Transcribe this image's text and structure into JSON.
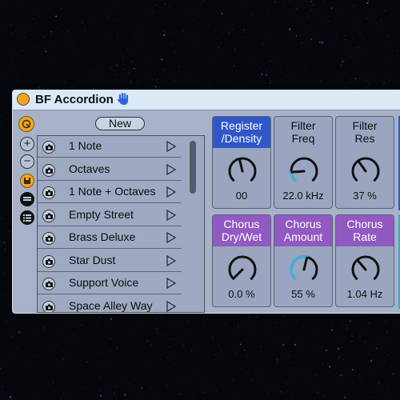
{
  "device": {
    "title": "BF Accordion",
    "icons": {
      "power": "power-icon",
      "hand": "hand-icon",
      "hot_swap": "hot-swap-icon",
      "add": "plus-icon",
      "remove": "minus-icon",
      "save": "save-icon",
      "folder": "folder-icon",
      "list": "list-icon"
    },
    "colors": {
      "accent_orange": "#f0a522",
      "header_blue": "#2f57c8",
      "header_purple": "#9159c2",
      "knob_cyan": "#38b6e6"
    }
  },
  "presets": {
    "new_label": "New",
    "items": [
      {
        "label": "1 Note"
      },
      {
        "label": "Octaves"
      },
      {
        "label": "1 Note + Octaves"
      },
      {
        "label": "Empty Street"
      },
      {
        "label": "Brass Deluxe"
      },
      {
        "label": "Star Dust"
      },
      {
        "label": "Support Voice"
      },
      {
        "label": "Space Alley Way"
      }
    ]
  },
  "knobs": [
    {
      "label_line1": "Register",
      "label_line2": "/Density",
      "value": "00",
      "header": "blue",
      "position": 0.45,
      "arc": false
    },
    {
      "label_line1": "Filter",
      "label_line2": "Freq",
      "value": "22.0 kHz",
      "header": "plain",
      "position": 0.15,
      "arc": true
    },
    {
      "label_line1": "Filter",
      "label_line2": "Res",
      "value": "37 %",
      "header": "plain",
      "position": 0.37,
      "arc": false
    },
    {
      "label_line1": "Chorus",
      "label_line2": "Dry/Wet",
      "value": "0.0 %",
      "header": "purple",
      "position": 0.0,
      "arc": false
    },
    {
      "label_line1": "Chorus",
      "label_line2": "Amount",
      "value": "55 %",
      "header": "purple",
      "position": 0.55,
      "arc": true
    },
    {
      "label_line1": "Chorus",
      "label_line2": "Rate",
      "value": "1.04 Hz",
      "header": "purple",
      "position": 0.35,
      "arc": false
    }
  ]
}
